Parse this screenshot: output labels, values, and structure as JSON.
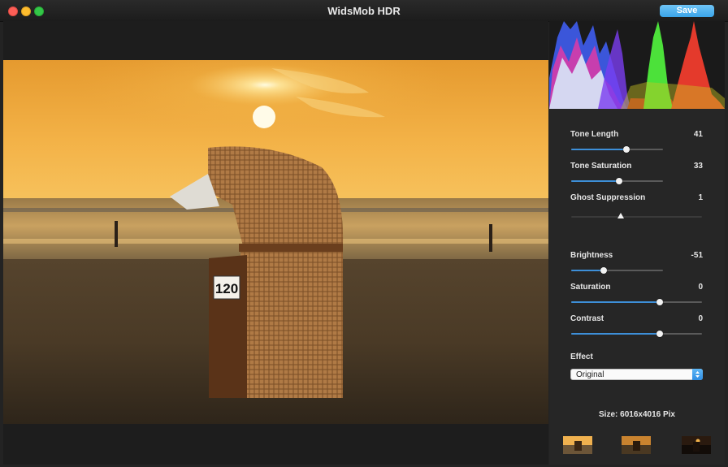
{
  "app": {
    "title": "WidsMob HDR",
    "save_label": "Save"
  },
  "sliders": [
    {
      "label": "Tone Length",
      "value": "41",
      "level": 0.6
    },
    {
      "label": "Tone Saturation",
      "value": "33",
      "level": 0.52
    },
    {
      "label": "Ghost Suppression",
      "value": "1",
      "level": 0.38
    },
    {
      "label": "Brightness",
      "value": "-51",
      "level": 0.35
    },
    {
      "label": "Saturation",
      "value": "0",
      "level": 0.68
    },
    {
      "label": "Contrast",
      "value": "0",
      "level": 0.68
    }
  ],
  "effect": {
    "label": "Effect",
    "selected": "Original"
  },
  "image_info": {
    "size_text": "Size: 6016x4016 Pix"
  },
  "photo": {
    "sign_text": "120"
  },
  "colors": {
    "accent": "#3d8fd8",
    "save_button": "#4aaeee",
    "panel": "#262626",
    "viewer": "#1d1d1d"
  },
  "icons": {
    "popup_arrows": "chevron-updown-icon"
  }
}
